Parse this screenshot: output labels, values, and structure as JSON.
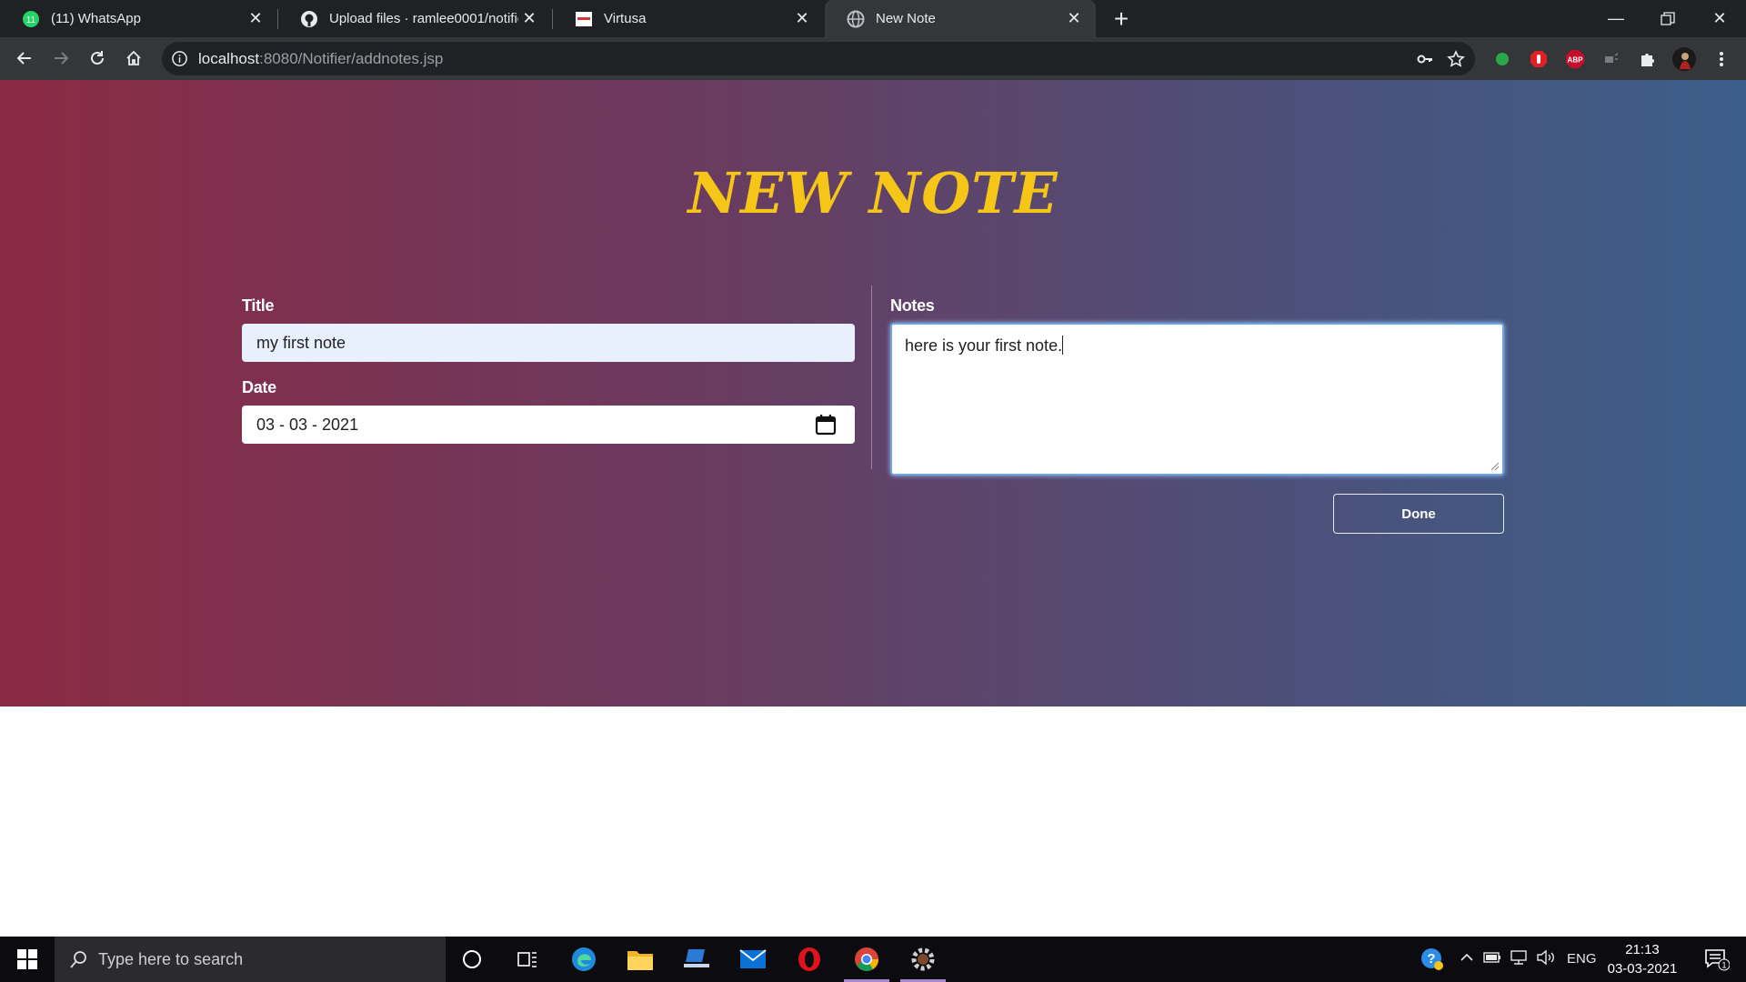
{
  "browser": {
    "tabs": [
      {
        "title": "(11) WhatsApp",
        "icon": "whatsapp-icon"
      },
      {
        "title": "Upload files · ramlee0001/notifie",
        "icon": "github-icon"
      },
      {
        "title": "Virtusa",
        "icon": "virtusa-icon"
      },
      {
        "title": "New Note",
        "icon": "globe-icon",
        "active": true
      }
    ],
    "url_host": "localhost",
    "url_rest": ":8080/Notifier/addnotes.jsp"
  },
  "page": {
    "heading": "NEW NOTE",
    "heading_color": "#f5c518",
    "title_label": "Title",
    "title_value": "my first note",
    "date_label": "Date",
    "date_value": "03 - 03 - 2021",
    "notes_label": "Notes",
    "notes_value": "here is your first note.",
    "done_label": "Done"
  },
  "taskbar": {
    "search_placeholder": "Type here to search",
    "language": "ENG",
    "time": "21:13",
    "date": "03-03-2021",
    "notification_count": "1"
  }
}
